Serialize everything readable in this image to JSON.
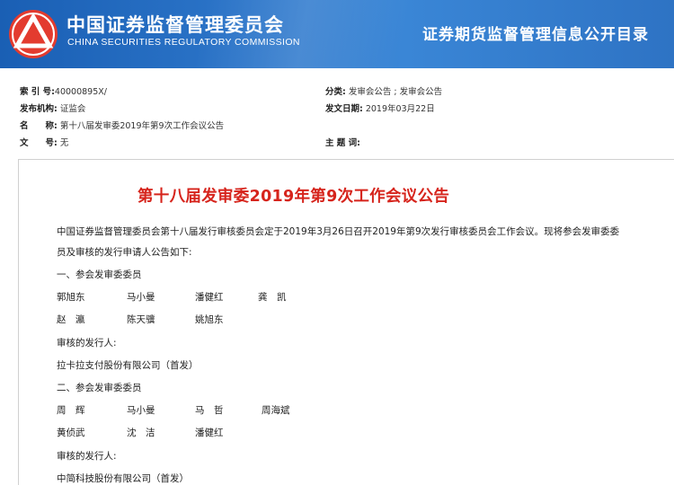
{
  "header": {
    "org_cn": "中国证券监督管理委员会",
    "org_en": "CHINA SECURITIES REGULATORY COMMISSION",
    "catalog_title": "证券期货监督管理信息公开目录",
    "logo_icon": "csrc-logo-icon",
    "colors": {
      "banner": "#2b74c8",
      "logo": "#e33b2f",
      "title_red": "#d6241c"
    }
  },
  "meta": {
    "index_label": "索 引 号:",
    "index_value": "40000895X/",
    "category_label": "分类:",
    "category_value": "发审会公告 ; 发审会公告",
    "publisher_label": "发布机构:",
    "publisher_value": "证监会",
    "date_label": "发文日期:",
    "date_value": "2019年03月22日",
    "name_label": "名　　称:",
    "name_value": "第十八届发审委2019年第9次工作会议公告",
    "docno_label": "文　　号:",
    "docno_value": "无",
    "keywords_label": "主 题 词:",
    "keywords_value": ""
  },
  "document": {
    "title": "第十八届发审委2019年第9次工作会议公告",
    "intro_line1": "中国证券监督管理委员会第十八届发行审核委员会定于2019年3月26日召开2019年第9次发行审核委员会工作会议。现将参会发审委委",
    "intro_line2": "员及审核的发行申请人公告如下:",
    "section1_heading": "一、参会发审委委员",
    "section1_members_row1": [
      "郭旭东",
      "马小曼",
      "潘健红",
      "龚　凯"
    ],
    "section1_members_row2": [
      "赵　瀛",
      "陈天骥",
      "姚旭东"
    ],
    "section1_issuer_label": "审核的发行人:",
    "section1_issuer": "拉卡拉支付股份有限公司（首发）",
    "section2_heading": "二、参会发审委委员",
    "section2_members_row1": [
      "周　辉",
      "马小曼",
      "马　哲",
      "周海斌"
    ],
    "section2_members_row2": [
      "黄侦武",
      "沈　洁",
      "潘健红"
    ],
    "section2_issuer_label": "审核的发行人:",
    "section2_issuer": "中简科技股份有限公司（首发）"
  }
}
